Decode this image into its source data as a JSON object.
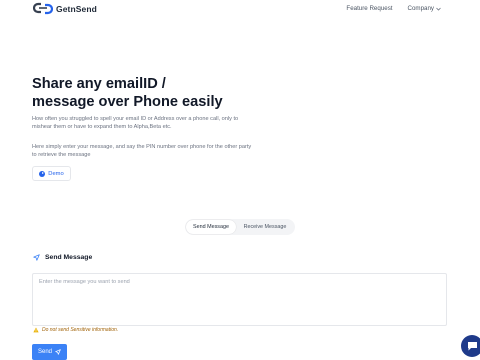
{
  "header": {
    "brand": "GetnSend",
    "nav": {
      "feature_request": "Feature Request",
      "company": "Company"
    }
  },
  "hero": {
    "title_line1": "Share any emailID /",
    "title_line2": "message over Phone easily",
    "description": "How often you struggled to spell your email ID or Address over a phone call, only to mishear them or have to expand them to Alpha,Beta etc.",
    "description2": "Here simply enter your message, and say the PIN number over phone for the other party to retrieve the message",
    "demo_label": "Demo"
  },
  "tabs": [
    {
      "label": "Send Message",
      "active": true
    },
    {
      "label": "Receive Message",
      "active": false
    }
  ],
  "send_section": {
    "title": "Send Message",
    "placeholder": "Enter the message you want to send",
    "warning": "Do not send Sensitive information.",
    "send_label": "Send"
  },
  "colors": {
    "accent": "#3b82f6",
    "warning": "#a16207",
    "chat": "#1e3a8a"
  },
  "icons": [
    "logo-icon",
    "chevron-down-icon",
    "play-icon",
    "paper-plane-icon",
    "warning-icon",
    "chat-icon"
  ]
}
